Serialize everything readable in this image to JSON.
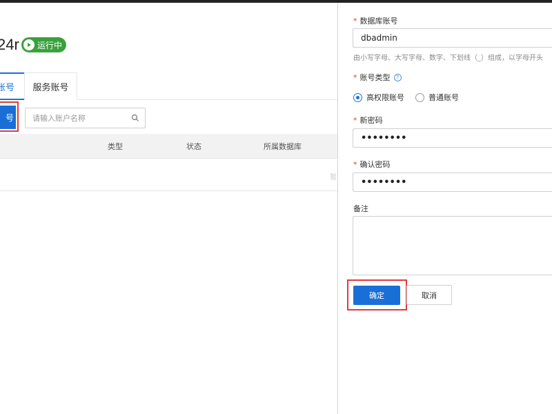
{
  "instance": {
    "title_fragment": "24r",
    "status": "运行中"
  },
  "tabs": {
    "active_fragment": "账号",
    "service": "服务账号"
  },
  "toolbar": {
    "create_fragment": "号",
    "search_placeholder": "请输入账户名称",
    "search_icon": "search-icon"
  },
  "table": {
    "columns": [
      "类型",
      "状态",
      "所属数据库"
    ],
    "row_hint": "暂"
  },
  "form": {
    "account_label": "数据库账号",
    "account_value": "dbadmin",
    "account_help": "由小写字母、大写字母、数字、下划线（_）组成，以字母开头",
    "type_label": "账号类型",
    "type_options": [
      "高权限账号",
      "普通账号"
    ],
    "type_selected": "高权限账号",
    "new_password_label": "新密码",
    "new_password_value": "••••••••",
    "confirm_password_label": "确认密码",
    "confirm_password_value": "••••••••",
    "remark_label": "备注",
    "ok_label": "确定",
    "cancel_label": "取消"
  },
  "colors": {
    "accent": "#1a6fd6",
    "running": "#3aa13c",
    "highlight": "#e0393e"
  }
}
